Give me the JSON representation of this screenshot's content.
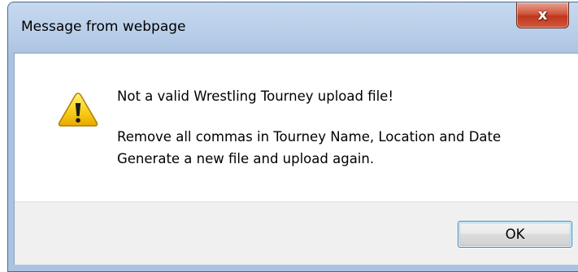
{
  "dialog": {
    "title": "Message from webpage",
    "close_glyph": "x",
    "icon": "warning-icon",
    "message_line1": "Not a valid Wrestling Tourney upload file!",
    "message_line2": "Remove all commas in Tourney Name, Location and Date",
    "message_line3": "Generate a new file and upload again.",
    "ok_label": "OK"
  },
  "colors": {
    "titlebar": "#b7cde8",
    "close_button": "#c9432a",
    "content_bg": "#ffffff",
    "footer_bg": "#f0f0f0",
    "warning_fill": "#f5c400",
    "button_focus_border": "#3c7fb1"
  }
}
